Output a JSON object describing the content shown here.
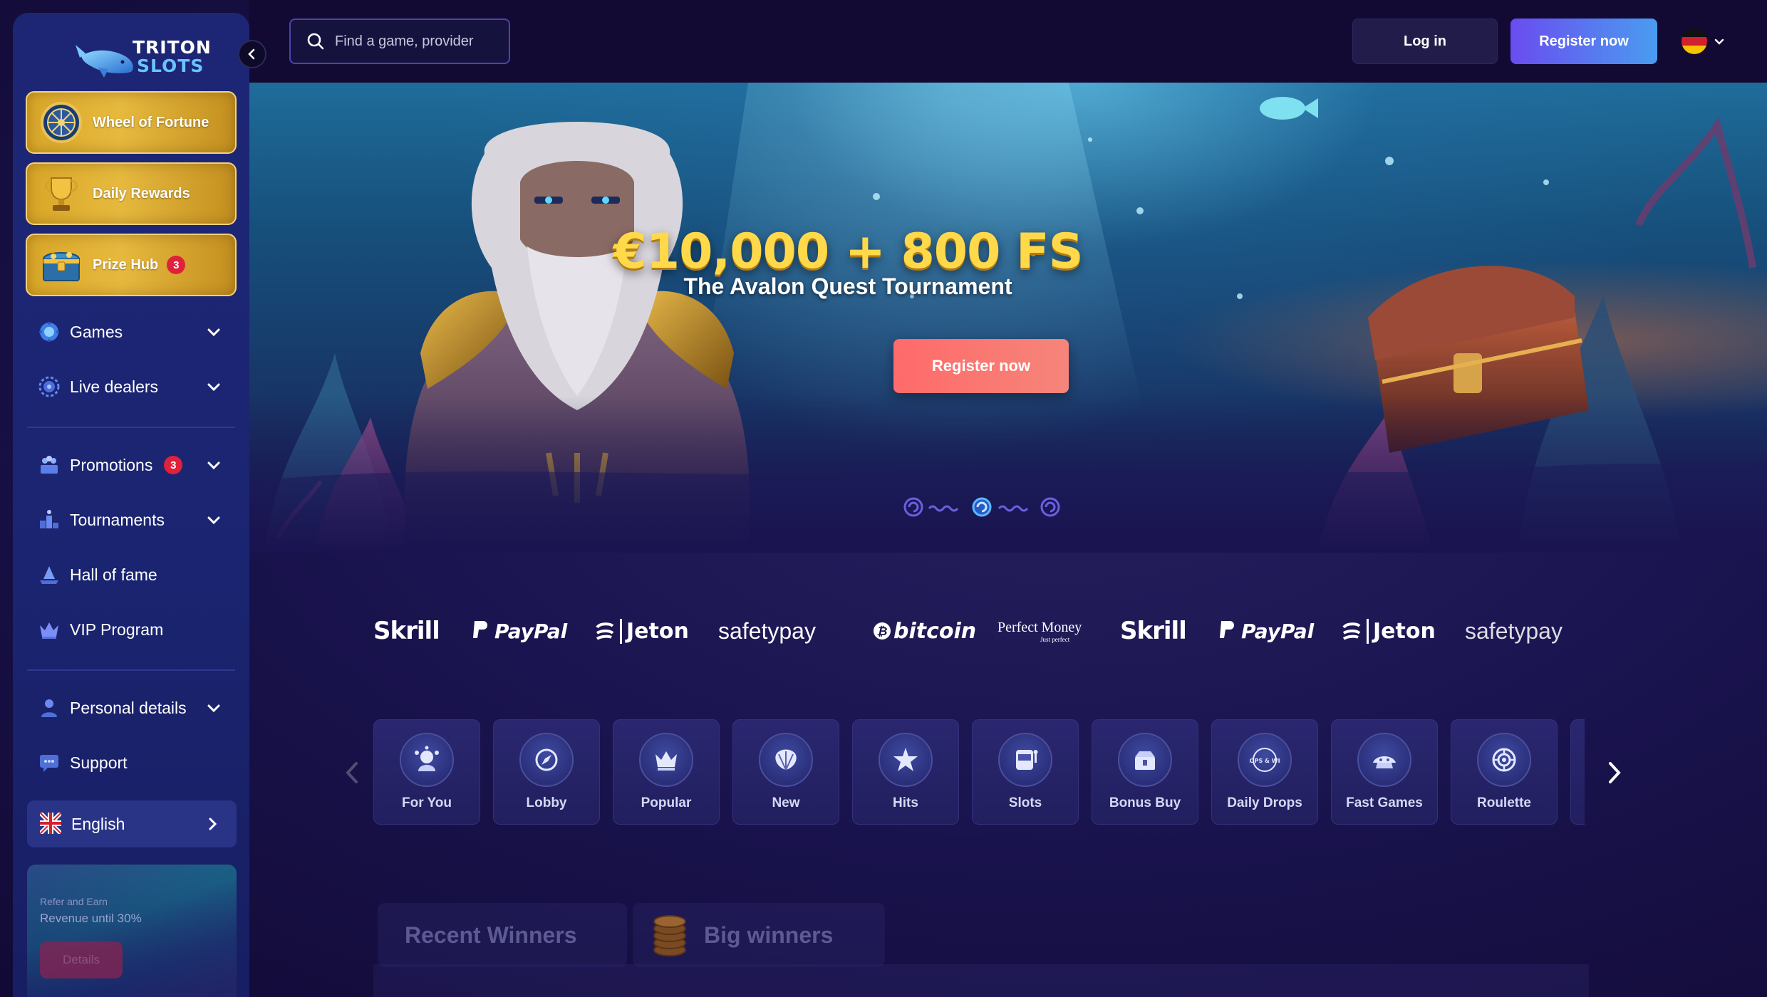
{
  "brand": {
    "line1": "TRITON",
    "line2": "SLOTS"
  },
  "header": {
    "search_placeholder": "Find a game, provider",
    "login_label": "Log in",
    "register_label": "Register now",
    "language_flag": "de-flag-icon"
  },
  "sidebar": {
    "promo_cards": [
      {
        "label": "Wheel of Fortune",
        "icon": "wheel-icon"
      },
      {
        "label": "Daily Rewards",
        "icon": "trophy-icon"
      },
      {
        "label": "Prize Hub",
        "icon": "treasure-chest-icon",
        "badge": "3"
      }
    ],
    "nav": [
      {
        "label": "Games",
        "icon": "games-icon",
        "expandable": true
      },
      {
        "label": "Live dealers",
        "icon": "live-dealers-icon",
        "expandable": true
      },
      {
        "label": "Promotions",
        "icon": "promotions-icon",
        "expandable": true,
        "badge": "3"
      },
      {
        "label": "Tournaments",
        "icon": "tournaments-icon",
        "expandable": true
      },
      {
        "label": "Hall of fame",
        "icon": "hall-of-fame-icon"
      },
      {
        "label": "VIP Program",
        "icon": "crown-icon"
      },
      {
        "label": "Personal details",
        "icon": "user-icon",
        "expandable": true
      },
      {
        "label": "Support",
        "icon": "support-icon"
      }
    ],
    "language": {
      "label": "English",
      "icon": "uk-flag-icon"
    },
    "refer": {
      "small": "Refer and Earn",
      "big": "Revenue until 30%",
      "button": "Details"
    }
  },
  "hero": {
    "title": "€10,000 + 800 FS",
    "subtitle": "The Avalon Quest Tournament",
    "cta": "Register now"
  },
  "payments": [
    "Skrill",
    "PayPal",
    "Jeton",
    "safetypay",
    "bitcoin",
    "Perfect Money",
    "Skrill",
    "PayPal",
    "Jeton",
    "safetypay"
  ],
  "perfect_money_tagline": "Just perfect",
  "categories": [
    {
      "label": "For You",
      "icon": "for-you-icon"
    },
    {
      "label": "Lobby",
      "icon": "lobby-icon"
    },
    {
      "label": "Popular",
      "icon": "crown-icon"
    },
    {
      "label": "New",
      "icon": "shell-icon"
    },
    {
      "label": "Hits",
      "icon": "starfish-icon"
    },
    {
      "label": "Slots",
      "icon": "slot-machine-icon"
    },
    {
      "label": "Bonus Buy",
      "icon": "bonus-buy-icon"
    },
    {
      "label": "Daily Drops",
      "icon": "daily-drops-icon"
    },
    {
      "label": "Fast Games",
      "icon": "fast-games-icon"
    },
    {
      "label": "Roulette",
      "icon": "roulette-icon"
    }
  ],
  "daily_drops_badge": "DROPS & WINS",
  "winners_tabs": [
    {
      "label": "Recent Winners"
    },
    {
      "label": "Big winners",
      "icon": "coins-icon"
    }
  ],
  "colors": {
    "sidebar_bg": "#1d2675",
    "page_bg": "#140b3a",
    "gold": "#e6b93e",
    "accent_gradient_start": "#6a4cf0",
    "accent_gradient_end": "#4a9cf0",
    "hero_cta": "#ff6a6a",
    "badge_red": "#e0213b"
  }
}
